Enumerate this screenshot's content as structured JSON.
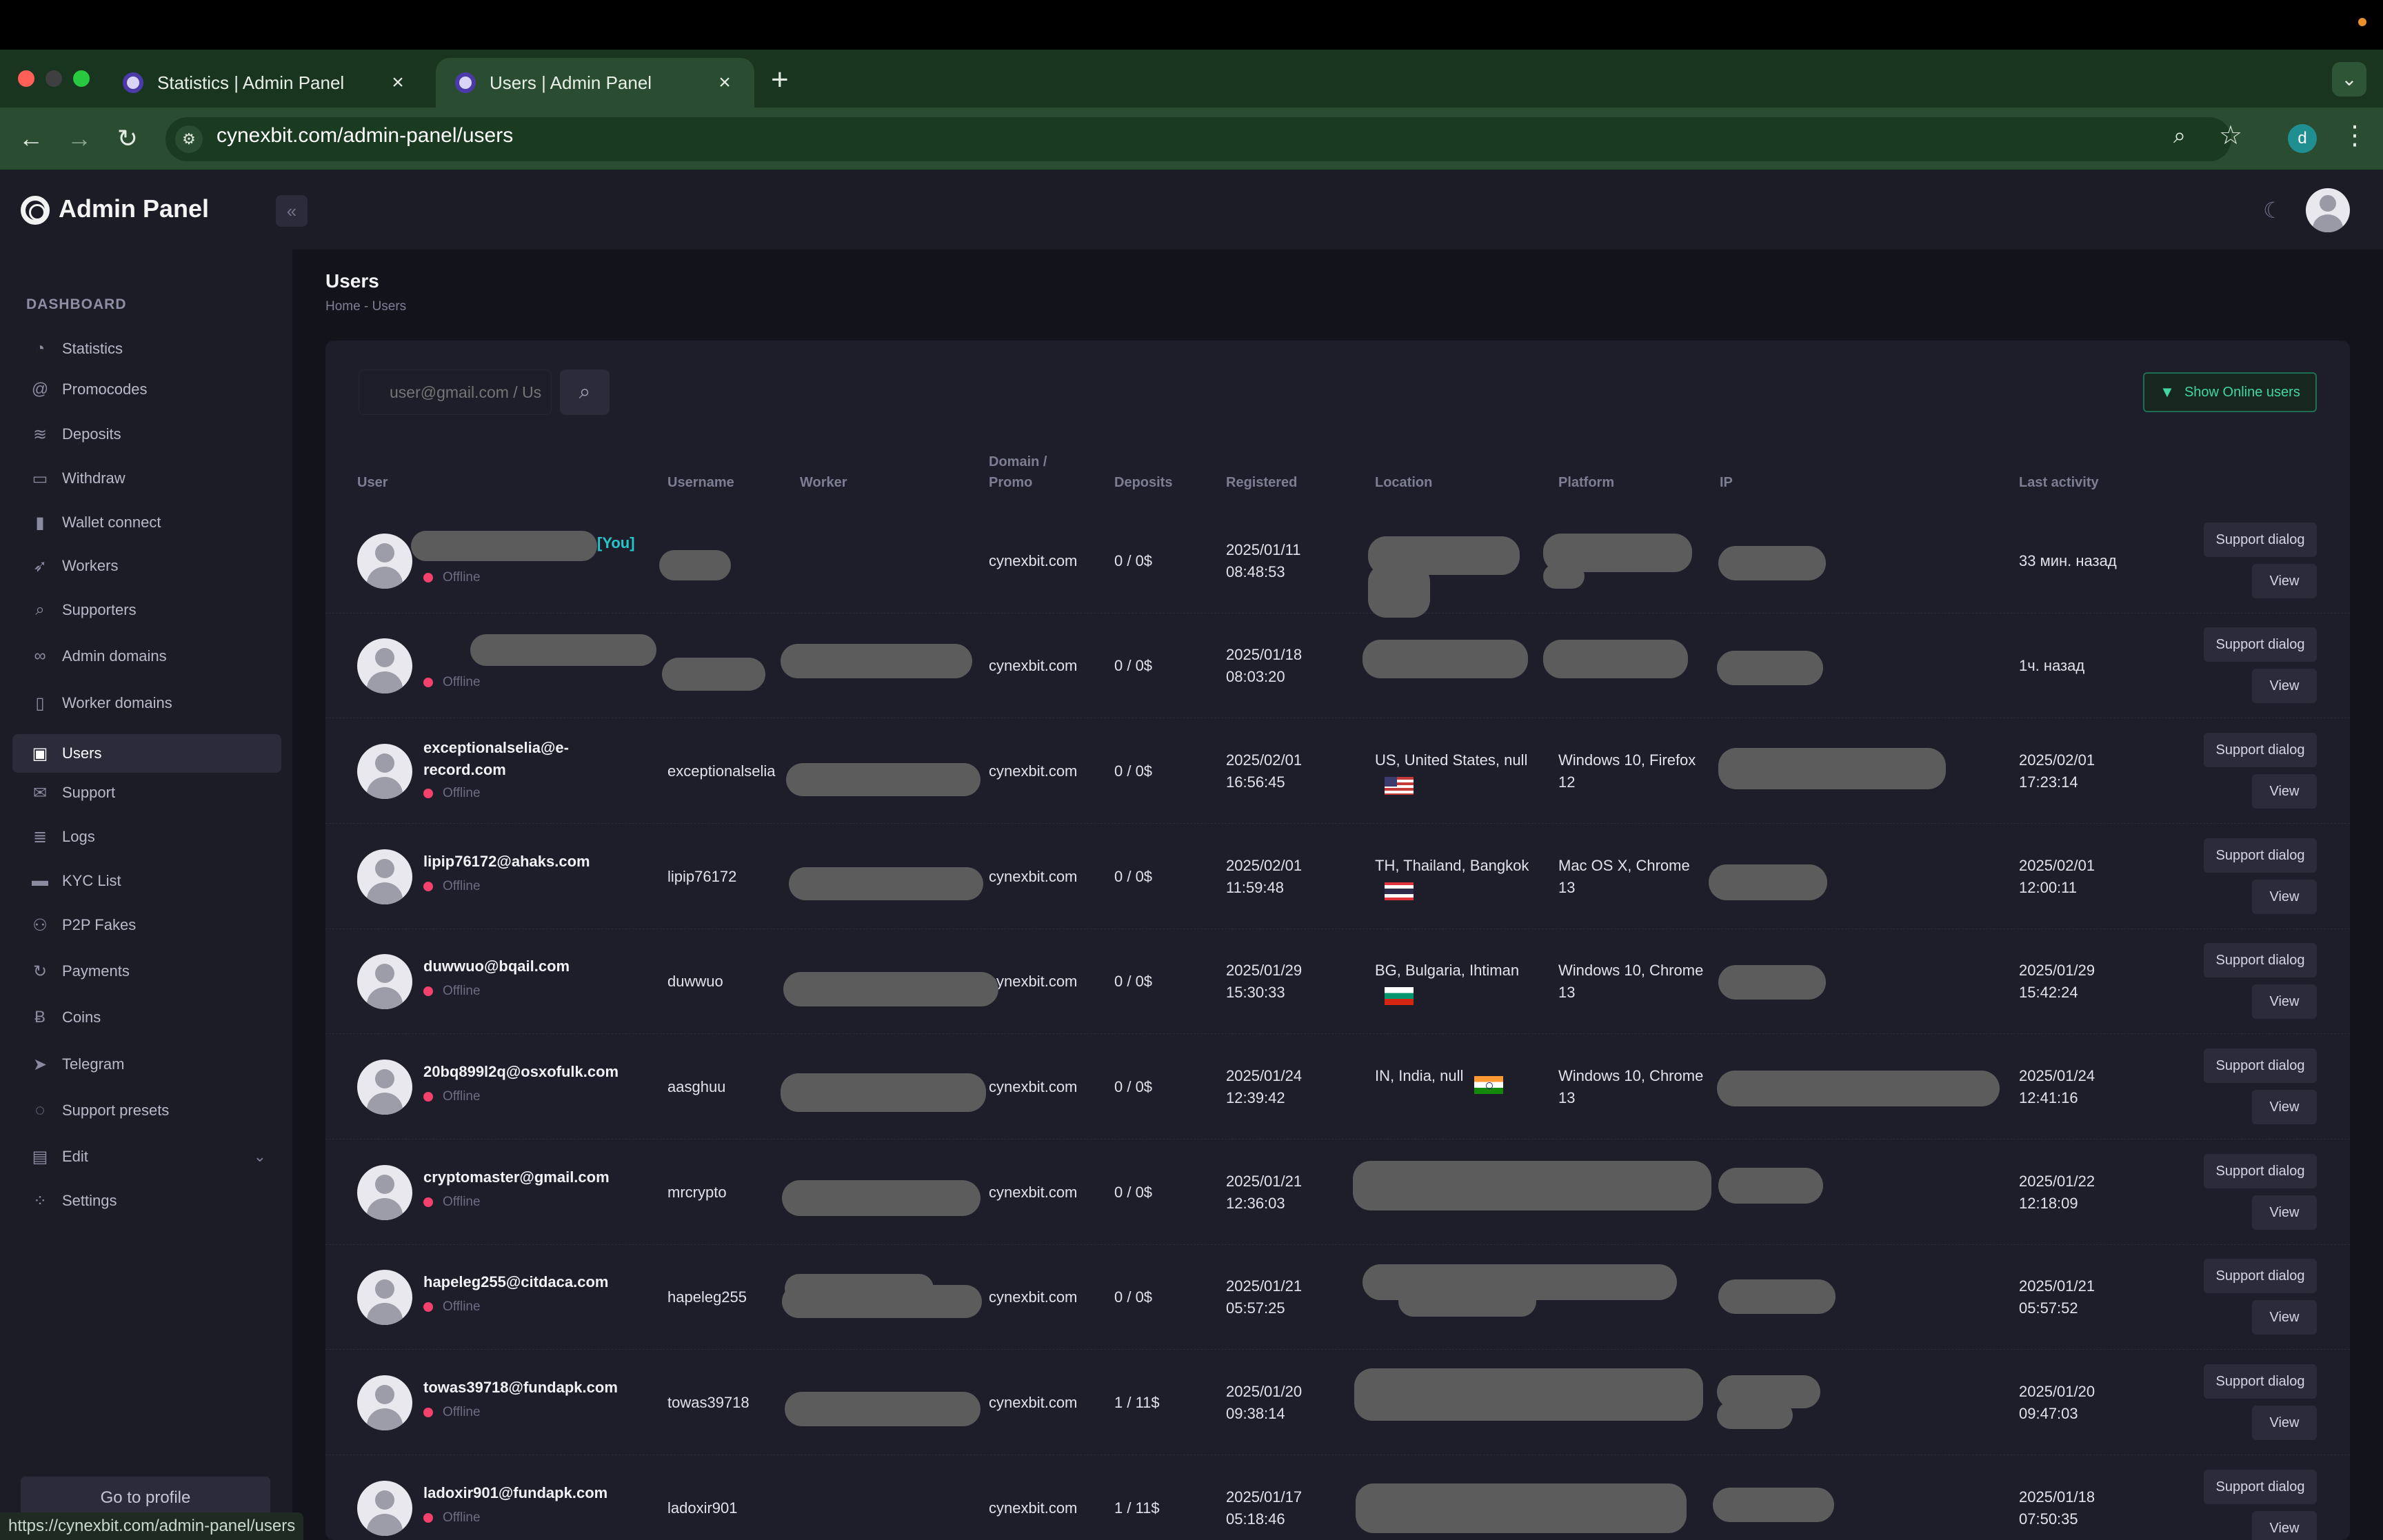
{
  "browser": {
    "tabs": [
      {
        "title": "Statistics | Admin Panel"
      },
      {
        "title": "Users | Admin Panel"
      }
    ],
    "url": "cynexbit.com/admin-panel/users",
    "profile_initial": "d",
    "status_url": "https://cynexbit.com/admin-panel/users"
  },
  "app": {
    "title": "Admin Panel",
    "page_title": "Users",
    "breadcrumb": "Home  -  Users"
  },
  "sidebar": {
    "section": "DASHBOARD",
    "items": [
      {
        "label": "Statistics",
        "icon": "pie-chart-icon"
      },
      {
        "label": "Promocodes",
        "icon": "at-sign-icon"
      },
      {
        "label": "Deposits",
        "icon": "coins-stack-icon"
      },
      {
        "label": "Withdraw",
        "icon": "bank-card-icon"
      },
      {
        "label": "Wallet connect",
        "icon": "wallet-icon"
      },
      {
        "label": "Workers",
        "icon": "rocket-icon"
      },
      {
        "label": "Supporters",
        "icon": "magnifier-icon"
      },
      {
        "label": "Admin domains",
        "icon": "link-icon"
      },
      {
        "label": "Worker domains",
        "icon": "map-icon"
      },
      {
        "label": "Users",
        "icon": "users-icon"
      },
      {
        "label": "Support",
        "icon": "envelope-icon"
      },
      {
        "label": "Logs",
        "icon": "layers-icon"
      },
      {
        "label": "KYC List",
        "icon": "id-card-icon"
      },
      {
        "label": "P2P Fakes",
        "icon": "user-switch-icon"
      },
      {
        "label": "Payments",
        "icon": "refresh-icon"
      },
      {
        "label": "Coins",
        "icon": "bitcoin-icon"
      },
      {
        "label": "Telegram",
        "icon": "send-icon"
      },
      {
        "label": "Support presets",
        "icon": "chat-icon"
      },
      {
        "label": "Edit",
        "icon": "document-icon"
      },
      {
        "label": "Settings",
        "icon": "grid-dots-icon"
      }
    ],
    "active": "Users",
    "profile_button": "Go to profile"
  },
  "toolbar": {
    "search_placeholder": "user@gmail.com / Us",
    "online_button": "Show Online users"
  },
  "table": {
    "headers": {
      "user": "User",
      "username": "Username",
      "worker": "Worker",
      "domain_line1": "Domain /",
      "domain_line2": "Promo",
      "deposits": "Deposits",
      "registered": "Registered",
      "location": "Location",
      "platform": "Platform",
      "ip": "IP",
      "last_activity": "Last activity"
    },
    "you_tag": "[You]",
    "status_label": "Offline",
    "support_label": "Support dialog",
    "view_label": "View",
    "rows": [
      {
        "email": "",
        "username": "",
        "domain": "cynexbit.com",
        "deposits": "0 / 0$",
        "reg_date": "2025/01/11",
        "reg_time": "08:48:53",
        "location": "",
        "flag": "",
        "platform_l1": "",
        "platform_l2": "",
        "last_l1": "33 мин. назад",
        "last_l2": ""
      },
      {
        "email": "",
        "username": "",
        "domain": "cynexbit.com",
        "deposits": "0 / 0$",
        "reg_date": "2025/01/18",
        "reg_time": "08:03:20",
        "location": "",
        "flag": "",
        "platform_l1": "",
        "platform_l2": "",
        "last_l1": "1ч. назад",
        "last_l2": ""
      },
      {
        "email": "exceptionalselia@e-record.com",
        "username": "exceptionalselia",
        "domain": "cynexbit.com",
        "deposits": "0 / 0$",
        "reg_date": "2025/02/01",
        "reg_time": "16:56:45",
        "location": "US, United States, null",
        "flag": "us",
        "platform_l1": "Windows 10, Firefox",
        "platform_l2": "12",
        "last_l1": "2025/02/01",
        "last_l2": "17:23:14"
      },
      {
        "email": "lipip76172@ahaks.com",
        "username": "lipip76172",
        "domain": "cynexbit.com",
        "deposits": "0 / 0$",
        "reg_date": "2025/02/01",
        "reg_time": "11:59:48",
        "location": "TH, Thailand, Bangkok",
        "flag": "th",
        "platform_l1": "Mac OS X, Chrome",
        "platform_l2": "13",
        "last_l1": "2025/02/01",
        "last_l2": "12:00:11"
      },
      {
        "email": "duwwuo@bqail.com",
        "username": "duwwuo",
        "domain": "cynexbit.com",
        "deposits": "0 / 0$",
        "reg_date": "2025/01/29",
        "reg_time": "15:30:33",
        "location": "BG, Bulgaria, Ihtiman",
        "flag": "bg",
        "platform_l1": "Windows 10, Chrome",
        "platform_l2": "13",
        "last_l1": "2025/01/29",
        "last_l2": "15:42:24"
      },
      {
        "email": "20bq899l2q@osxofulk.com",
        "username": "aasghuu",
        "domain": "cynexbit.com",
        "deposits": "0 / 0$",
        "reg_date": "2025/01/24",
        "reg_time": "12:39:42",
        "location": "IN, India, null",
        "flag": "in",
        "platform_l1": "Windows 10, Chrome",
        "platform_l2": "13",
        "last_l1": "2025/01/24",
        "last_l2": "12:41:16"
      },
      {
        "email": "cryptomaster@gmail.com",
        "username": "mrcrypto",
        "domain": "cynexbit.com",
        "deposits": "0 / 0$",
        "reg_date": "2025/01/21",
        "reg_time": "12:36:03",
        "location": "",
        "flag": "",
        "platform_l1": "",
        "platform_l2": "",
        "last_l1": "2025/01/22",
        "last_l2": "12:18:09"
      },
      {
        "email": "hapeleg255@citdaca.com",
        "username": "hapeleg255",
        "domain": "cynexbit.com",
        "deposits": "0 / 0$",
        "reg_date": "2025/01/21",
        "reg_time": "05:57:25",
        "location": "",
        "flag": "",
        "platform_l1": "",
        "platform_l2": "",
        "last_l1": "2025/01/21",
        "last_l2": "05:57:52"
      },
      {
        "email": "towas39718@fundapk.com",
        "username": "towas39718",
        "domain": "cynexbit.com",
        "deposits": "1 / 11$",
        "reg_date": "2025/01/20",
        "reg_time": "09:38:14",
        "location": "",
        "flag": "",
        "platform_l1": "",
        "platform_l2": "",
        "last_l1": "2025/01/20",
        "last_l2": "09:47:03"
      },
      {
        "email": "ladoxir901@fundapk.com",
        "username": "ladoxir901",
        "domain": "cynexbit.com",
        "deposits": "1 / 11$",
        "reg_date": "2025/01/17",
        "reg_time": "05:18:46",
        "location": "",
        "flag": "",
        "platform_l1": "",
        "platform_l2": "",
        "last_l1": "2025/01/18",
        "last_l2": "07:50:35"
      }
    ]
  },
  "colors": {
    "tabstrip": "#19351f",
    "toolbar": "#2a4d31",
    "sidebar_bg": "#1c1c27",
    "content_bg": "#13131b",
    "card_bg": "#1e1e2b",
    "accent_green": "#42d6a2",
    "you_tag": "#26c6c8",
    "offline_dot": "#f1416c"
  }
}
